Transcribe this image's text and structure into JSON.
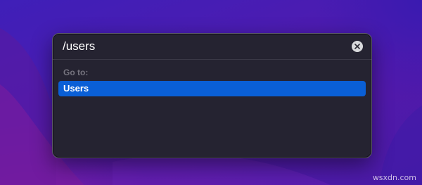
{
  "dialog": {
    "path_value": "/users",
    "clear_icon": "close-circle-icon",
    "section_label": "Go to:",
    "results": [
      {
        "label": "Users",
        "selected": true
      }
    ]
  },
  "watermark": "wsxdn.com",
  "colors": {
    "accent": "#0a5fd6",
    "panel": "#252331",
    "desktop": "#4a1cb2"
  }
}
